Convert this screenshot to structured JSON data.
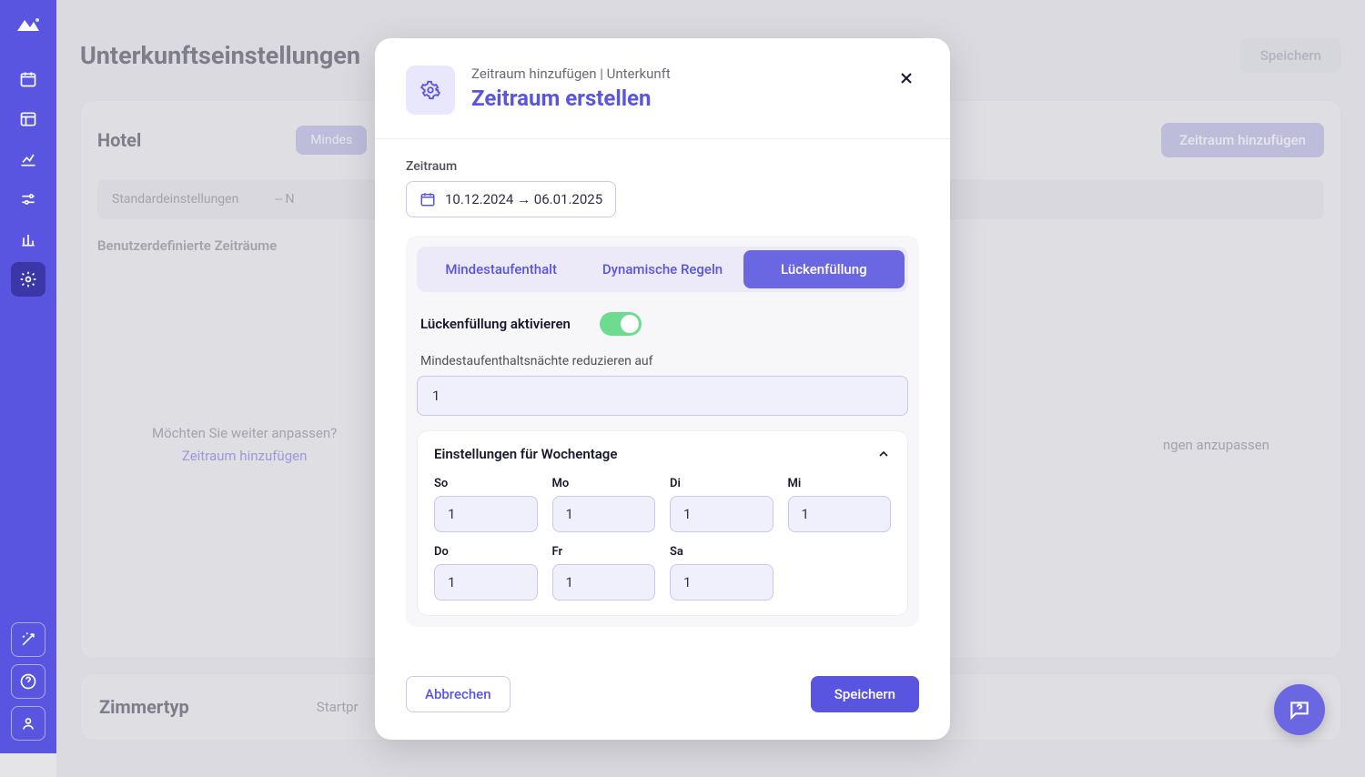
{
  "page": {
    "title": "Unterkunftseinstellungen",
    "save_label": "Speichern"
  },
  "hotel_card": {
    "title": "Hotel",
    "tab_label": "Mindes",
    "add_period_label": "Zeitraum hinzufügen",
    "defaults_label": "Standardeinstellungen",
    "defaults_value": "-- N",
    "custom_periods_label": "Benutzerdefinierte Zeiträume",
    "prompt_text": "Möchten Sie weiter anpassen?",
    "prompt_link": "Zeitraum hinzufügen",
    "right_hint": "ngen anzupassen"
  },
  "roomtype_card": {
    "title": "Zimmertyp",
    "col_label": "Startpr"
  },
  "modal": {
    "breadcrumb": "Zeitraum hinzufügen | Unterkunft",
    "title": "Zeitraum erstellen",
    "field_zeitraum_label": "Zeitraum",
    "date_range": "10.12.2024 → 06.01.2025",
    "tabs": {
      "min_stay": "Mindestaufenthalt",
      "dynamic": "Dynamische Regeln",
      "gap_fill": "Lückenfüllung"
    },
    "gap_fill": {
      "activate_label": "Lückenfüllung aktivieren",
      "activate_on": true,
      "reduce_label": "Mindestaufenthaltsnächte reduzieren auf",
      "reduce_value": "1",
      "weekday_title": "Einstellungen für Wochentage",
      "days": [
        {
          "label": "So",
          "value": "1"
        },
        {
          "label": "Mo",
          "value": "1"
        },
        {
          "label": "Di",
          "value": "1"
        },
        {
          "label": "Mi",
          "value": "1"
        },
        {
          "label": "Do",
          "value": "1"
        },
        {
          "label": "Fr",
          "value": "1"
        },
        {
          "label": "Sa",
          "value": "1"
        }
      ]
    },
    "cancel_label": "Abbrechen",
    "save_label": "Speichern"
  }
}
